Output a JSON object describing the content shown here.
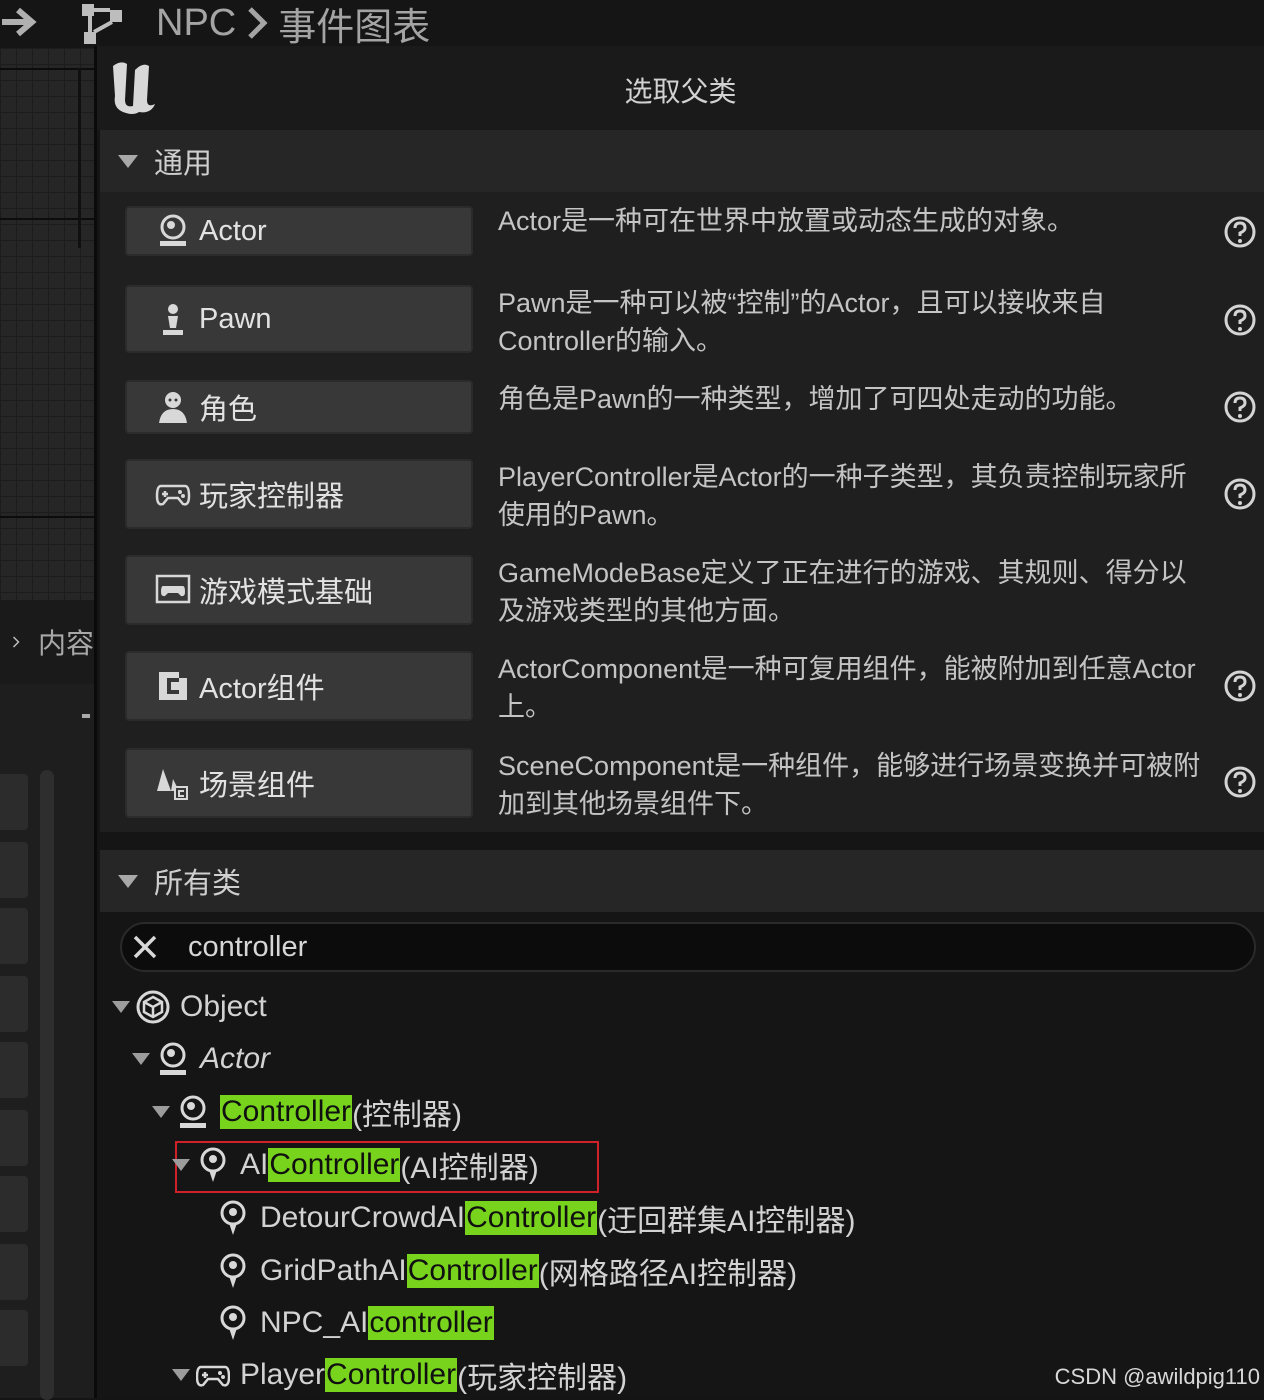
{
  "breadcrumb": {
    "root": "NPC",
    "current": "事件图表"
  },
  "background": {
    "content_label": "内容"
  },
  "dialog": {
    "title": "选取父类",
    "common_section": "通用",
    "all_section": "所有类",
    "common_classes": [
      {
        "label": "Actor",
        "icon": "actor-icon",
        "description": "Actor是一种可在世界中放置或动态生成的对象。"
      },
      {
        "label": "Pawn",
        "icon": "pawn-icon",
        "description": "Pawn是一种可以被“控制”的Actor，且可以接收来自Controller的输入。"
      },
      {
        "label": "角色",
        "icon": "character-icon",
        "description": "角色是Pawn的一种类型，增加了可四处走动的功能。"
      },
      {
        "label": "玩家控制器",
        "icon": "gamepad-icon",
        "description": "PlayerController是Actor的一种子类型，其负责控制玩家所使用的Pawn。"
      },
      {
        "label": "游戏模式基础",
        "icon": "game-mode-icon",
        "description": "GameModeBase定义了正在进行的游戏、其规则、得分以及游戏类型的其他方面。"
      },
      {
        "label": "Actor组件",
        "icon": "actor-component-icon",
        "description": "ActorComponent是一种可复用组件，能被附加到任意Actor上。"
      },
      {
        "label": "场景组件",
        "icon": "scene-component-icon",
        "description": "SceneComponent是一种组件，能够进行场景变换并可被附加到其他场景组件下。"
      }
    ],
    "search": {
      "value": "controller"
    },
    "tree": [
      {
        "pre": "Object",
        "match": "",
        "post": ""
      },
      {
        "pre": "Actor",
        "match": "",
        "post": ""
      },
      {
        "pre": "",
        "match": "Controller",
        "post": " (控制器)"
      },
      {
        "pre": "AI",
        "match": "Controller",
        "post": " (AI控制器)"
      },
      {
        "pre": "DetourCrowdAI",
        "match": "Controller",
        "post": " (迂回群集AI控制器)"
      },
      {
        "pre": "GridPathAI",
        "match": "Controller",
        "post": " (网格路径AI控制器)"
      },
      {
        "pre": "NPC_AI",
        "match": "controller",
        "post": ""
      },
      {
        "pre": "Player",
        "match": "Controller",
        "post": " (玩家控制器)"
      }
    ]
  },
  "watermark": "CSDN @awildpig110",
  "colors": {
    "highlight": "#78d31c",
    "selection_border": "#d0202a",
    "panel": "#1f1f1f"
  }
}
